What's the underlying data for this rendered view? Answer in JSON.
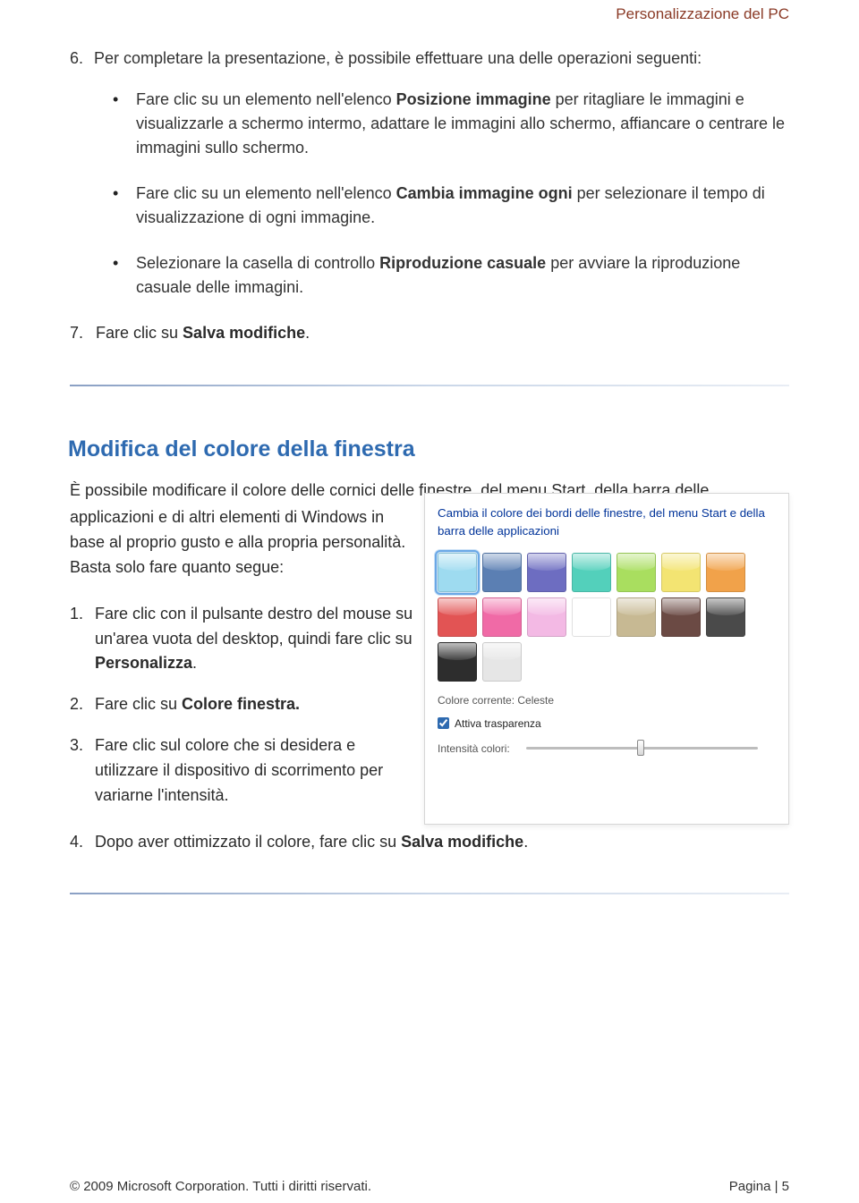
{
  "header": {
    "title": "Personalizzazione del PC"
  },
  "step6": {
    "number": "6.",
    "text_before": "Per completare la presentazione, è possibile effettuare una delle operazioni seguenti:"
  },
  "bullets": [
    {
      "pre1": "Fare clic su un elemento nell'elenco ",
      "b1": "Posizione immagine",
      "post1": " per ritagliare le immagini e visualizzarle a schermo intermo, adattare le immagini allo schermo, affiancare o centrare le immagini sullo schermo."
    },
    {
      "pre1": "Fare clic su un elemento nell'elenco ",
      "b1": "Cambia immagine ogni",
      "post1": " per selezionare il tempo di visualizzazione di ogni immagine."
    },
    {
      "pre1": "Selezionare la casella di controllo ",
      "b1": "Riproduzione casuale",
      "post1": " per avviare la riproduzione casuale delle immagini."
    }
  ],
  "step7": {
    "number": "7.",
    "pre": "Fare clic su ",
    "b": "Salva modifiche",
    "post": "."
  },
  "section": {
    "title": "Modifica del colore della finestra",
    "intro_line1": "È possibile modificare il colore delle cornici delle finestre, del menu Start, della barra delle",
    "intro_rest": "applicazioni e di altri elementi di Windows in base al proprio gusto e alla propria personalità. Basta solo fare quanto segue:"
  },
  "steps_lower": [
    {
      "num": "1.",
      "pre": "Fare clic con il pulsante destro del mouse su un'area vuota del desktop, quindi fare clic su ",
      "b": "Personalizza",
      "post": "."
    },
    {
      "num": "2.",
      "pre": "Fare clic su ",
      "b": "Colore finestra.",
      "post": ""
    },
    {
      "num": "3.",
      "pre": "Fare clic sul colore che si desidera e utilizzare il dispositivo di scorrimento per variarne l'intensità.",
      "b": "",
      "post": ""
    },
    {
      "num": "4.",
      "pre": "Dopo aver ottimizzato il colore, fare clic su ",
      "b": "Salva modifiche",
      "post": "."
    }
  ],
  "panel": {
    "title": "Cambia il colore dei bordi delle finestre, del menu Start e della barra delle applicazioni",
    "current_label": "Colore corrente: Celeste",
    "checkbox_label": "Attiva trasparenza",
    "intensity_label": "Intensità colori:",
    "swatches": [
      {
        "color": "#9edbf0",
        "selected": true
      },
      {
        "color": "#5b7fb3",
        "selected": false
      },
      {
        "color": "#6d6dc1",
        "selected": false
      },
      {
        "color": "#53d0bb",
        "selected": false
      },
      {
        "color": "#a9de5f",
        "selected": false
      },
      {
        "color": "#f3e472",
        "selected": false
      },
      {
        "color": "#f1a24a",
        "selected": false
      },
      {
        "color": "#e25454",
        "selected": false
      },
      {
        "color": "#f06aa6",
        "selected": false
      },
      {
        "color": "#f3b9e4",
        "selected": false
      },
      {
        "color": "#ffffff",
        "selected": false
      },
      {
        "color": "#c7b993",
        "selected": false
      },
      {
        "color": "#6b4a44",
        "selected": false
      },
      {
        "color": "#4a4a4a",
        "selected": false
      },
      {
        "color": "#2d2d2d",
        "selected": false
      },
      {
        "color": "#e6e6e6",
        "selected": false
      }
    ]
  },
  "footer": {
    "left": "© 2009 Microsoft Corporation. Tutti i diritti riservati.",
    "right": "Pagina | 5"
  }
}
